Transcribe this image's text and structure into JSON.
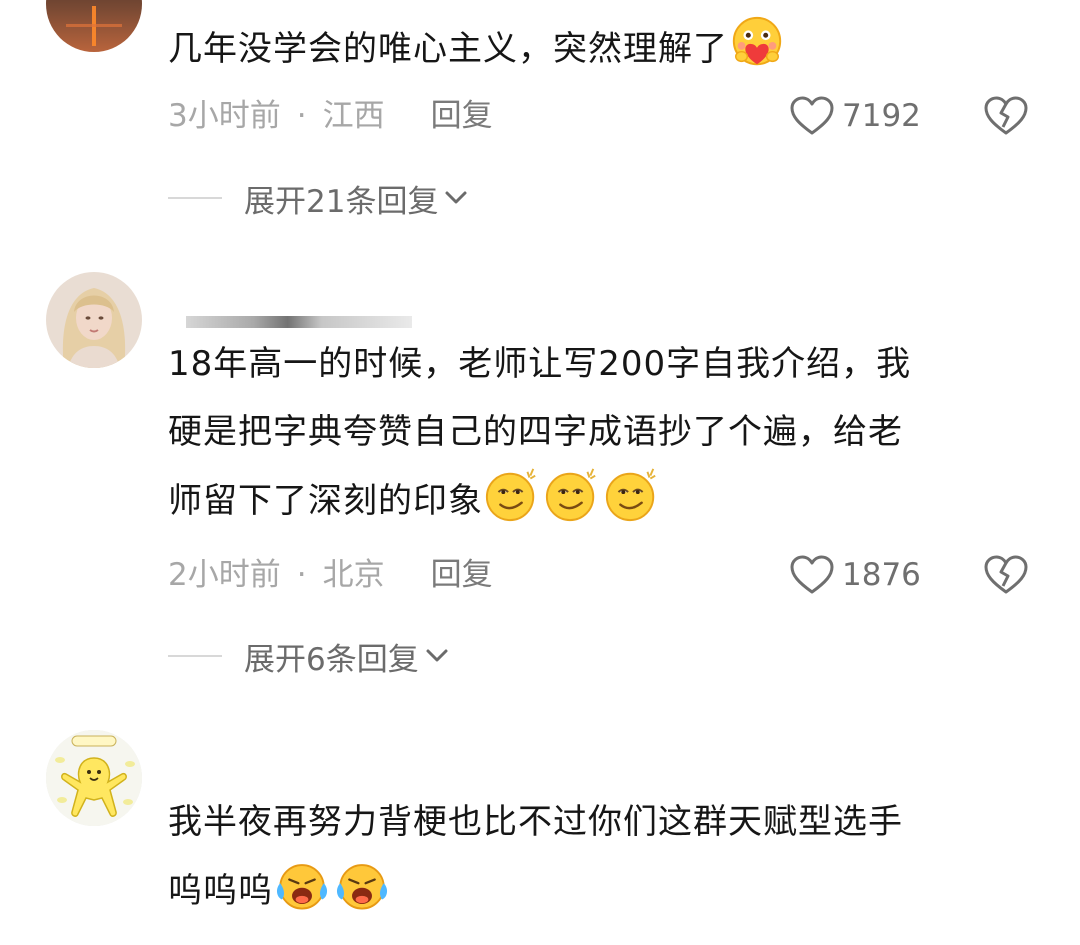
{
  "comments": [
    {
      "text": "几年没学会的唯心主义，突然理解了",
      "emojis": [
        "heart-hug-emoji"
      ],
      "time": "3小时前",
      "location": "江西",
      "reply_label": "回复",
      "likes": "7192",
      "expand_label": "展开21条回复"
    },
    {
      "text_lines": [
        "18年高一的时候，老师让写200字自我介绍，我",
        "硬是把字典夸赞自己的四字成语抄了个遍，给老",
        "师留下了深刻的印象"
      ],
      "emojis": [
        "smug-emoji",
        "smug-emoji",
        "smug-emoji"
      ],
      "time": "2小时前",
      "location": "北京",
      "reply_label": "回复",
      "likes": "1876",
      "expand_label": "展开6条回复"
    },
    {
      "text_lines": [
        "我半夜再努力背梗也比不过你们这群天赋型选手",
        "呜呜呜"
      ],
      "emojis": [
        "crying-emoji",
        "crying-emoji"
      ]
    }
  ],
  "meta_separator": "·",
  "colors": {
    "text": "#161616",
    "meta": "#a7a7a7",
    "reply": "#7a7a7a",
    "icon": "#6f6f6f",
    "divider": "#d8d8d8"
  }
}
